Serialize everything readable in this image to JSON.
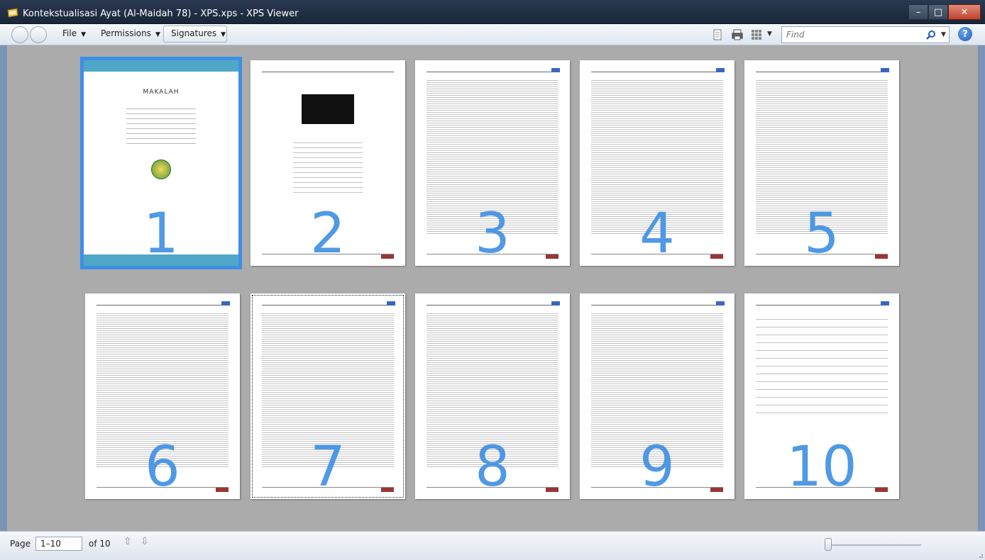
{
  "window": {
    "title": "Kontekstualisasi Ayat (Al-Maidah 78) - XPS.xps - XPS Viewer",
    "minimize": "–",
    "maximize": "□",
    "close": "✕"
  },
  "menu": {
    "file": "File",
    "permissions": "Permissions",
    "signatures": "Signatures",
    "caret": "▼"
  },
  "toolbar": {
    "find_placeholder": "Find",
    "help": "?"
  },
  "pages": [
    {
      "number": "1"
    },
    {
      "number": "2"
    },
    {
      "number": "3"
    },
    {
      "number": "4"
    },
    {
      "number": "5"
    },
    {
      "number": "6"
    },
    {
      "number": "7"
    },
    {
      "number": "8"
    },
    {
      "number": "9"
    },
    {
      "number": "10"
    }
  ],
  "cover": {
    "title": "MAKALAH"
  },
  "status": {
    "page_label": "Page",
    "page_range": "1–10",
    "of_label": "of 10",
    "up_arrow": "⇧",
    "down_arrow": "⇩"
  },
  "colors": {
    "selection": "#3d8fe6",
    "page_number": "#3c8ee3",
    "cover_band": "#4fa7c7"
  }
}
